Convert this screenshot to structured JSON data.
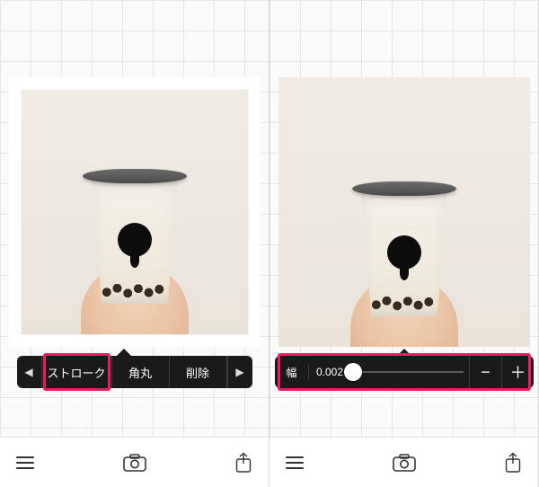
{
  "left": {
    "toolbar": {
      "prev_glyph": "◀",
      "next_glyph": "▶",
      "segments": [
        "ストローク",
        "角丸",
        "削除"
      ],
      "active_index": 0
    }
  },
  "right": {
    "slider": {
      "label": "幅",
      "value": "0.002",
      "minus": "−",
      "plus": "＋",
      "thumb_percent": 2
    }
  },
  "highlight_color": "#ec1b63"
}
